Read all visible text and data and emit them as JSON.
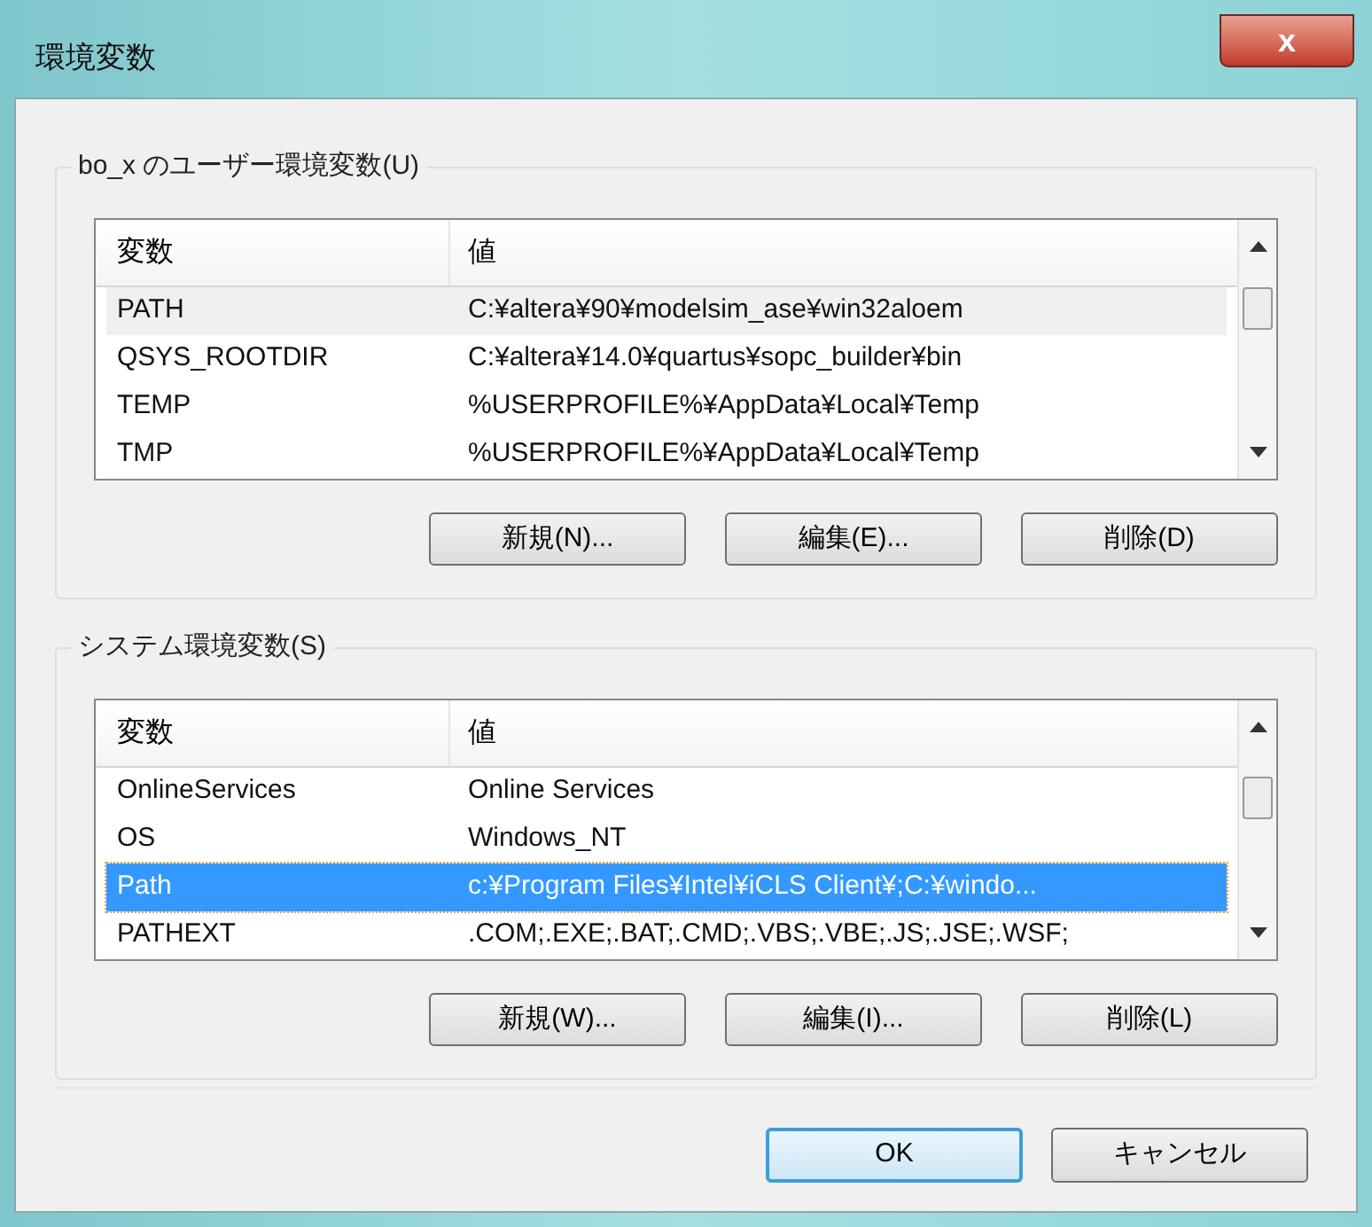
{
  "window": {
    "title": "環境変数",
    "close": "x"
  },
  "groups": [
    {
      "label": "bo_x のユーザー環境変数(U)",
      "focused": false,
      "columns": [
        "変数",
        "値"
      ],
      "rows": [
        {
          "name": "PATH",
          "value": "C:¥altera¥90¥modelsim_ase¥win32aloem",
          "selected": true
        },
        {
          "name": "QSYS_ROOTDIR",
          "value": "C:¥altera¥14.0¥quartus¥sopc_builder¥bin",
          "selected": false
        },
        {
          "name": "TEMP",
          "value": "%USERPROFILE%¥AppData¥Local¥Temp",
          "selected": false
        },
        {
          "name": "TMP",
          "value": "%USERPROFILE%¥AppData¥Local¥Temp",
          "selected": false
        }
      ],
      "buttons": [
        "新規(N)...",
        "編集(E)...",
        "削除(D)"
      ]
    },
    {
      "label": "システム環境変数(S)",
      "focused": true,
      "columns": [
        "変数",
        "値"
      ],
      "rows": [
        {
          "name": "OnlineServices",
          "value": "Online Services",
          "selected": false
        },
        {
          "name": "OS",
          "value": "Windows_NT",
          "selected": false
        },
        {
          "name": "Path",
          "value": "c:¥Program Files¥Intel¥iCLS Client¥;C:¥windo...",
          "selected": true
        },
        {
          "name": "PATHEXT",
          "value": ".COM;.EXE;.BAT;.CMD;.VBS;.VBE;.JS;.JSE;.WSF;",
          "selected": false
        }
      ],
      "buttons": [
        "新規(W)...",
        "編集(I)...",
        "削除(L)"
      ]
    }
  ],
  "footer_buttons": [
    {
      "label": "OK",
      "default": true
    },
    {
      "label": "キャンセル",
      "default": false
    }
  ]
}
